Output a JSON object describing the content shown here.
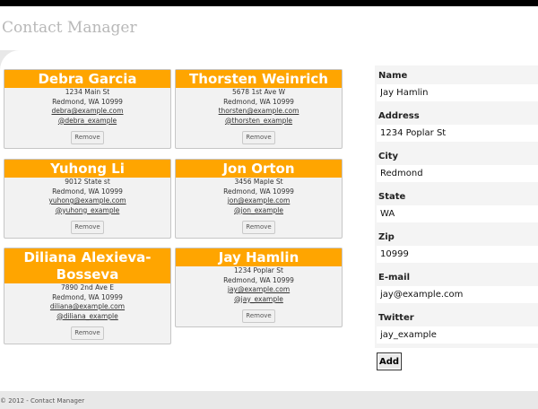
{
  "app": {
    "title": "Contact Manager",
    "footer": "© 2012 - Contact Manager"
  },
  "contacts": [
    {
      "name": "Debra Garcia",
      "street": "1234 Main St",
      "city_line": "Redmond, WA 10999",
      "email": "debra@example.com",
      "twitter": "@debra_example",
      "remove_label": "Remove"
    },
    {
      "name": "Thorsten Weinrich",
      "street": "5678 1st Ave W",
      "city_line": "Redmond, WA 10999",
      "email": "thorsten@example.com",
      "twitter": "@thorsten_example",
      "remove_label": "Remove"
    },
    {
      "name": "Yuhong Li",
      "street": "9012 State st",
      "city_line": "Redmond, WA 10999",
      "email": "yuhong@example.com",
      "twitter": "@yuhong_example",
      "remove_label": "Remove"
    },
    {
      "name": "Jon Orton",
      "street": "3456 Maple St",
      "city_line": "Redmond, WA 10999",
      "email": "jon@example.com",
      "twitter": "@jon_example",
      "remove_label": "Remove"
    },
    {
      "name": "Diliana Alexieva-Bosseva",
      "street": "7890 2nd Ave E",
      "city_line": "Redmond, WA 10999",
      "email": "diliana@example.com",
      "twitter": "@diliana_example",
      "remove_label": "Remove"
    },
    {
      "name": "Jay Hamlin",
      "street": "1234 Poplar St",
      "city_line": "Redmond, WA 10999",
      "email": "jay@example.com",
      "twitter": "@jay_example",
      "remove_label": "Remove"
    }
  ],
  "form": {
    "name": {
      "label": "Name",
      "value": "Jay Hamlin"
    },
    "address": {
      "label": "Address",
      "value": "1234 Poplar St"
    },
    "city": {
      "label": "City",
      "value": "Redmond"
    },
    "state": {
      "label": "State",
      "value": "WA"
    },
    "zip": {
      "label": "Zip",
      "value": "10999"
    },
    "email": {
      "label": "E-mail",
      "value": "jay@example.com"
    },
    "twitter": {
      "label": "Twitter",
      "value": "jay_example"
    },
    "add_label": "Add"
  },
  "colors": {
    "accent": "#ffa500",
    "title": "#b8b8b8"
  }
}
